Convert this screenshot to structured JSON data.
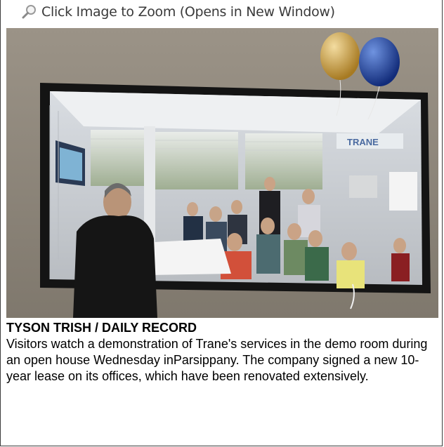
{
  "zoom": {
    "label": "Click Image to Zoom (Opens in New Window)",
    "icon": "magnifier-icon"
  },
  "photo": {
    "balloon_colors": [
      "#c99b3a",
      "#1f4aa6"
    ],
    "wall_sign": "TRANE"
  },
  "caption": {
    "credit": "TYSON TRISH / DAILY RECORD",
    "text": "Visitors watch a demonstration of Trane's services in the demo room during an open house Wednesday inParsippany. The company signed a new 10-year lease on its offices, which have been renovated extensively."
  }
}
